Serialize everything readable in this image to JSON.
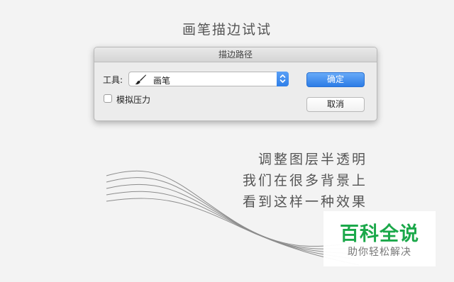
{
  "page": {
    "title": "画笔描边试试"
  },
  "dialog": {
    "title": "描边路径",
    "tool_label": "工具:",
    "tool_value": "画笔",
    "tool_icon": "brush-icon",
    "checkbox_label": "模拟压力",
    "checkbox_checked": false,
    "ok_label": "确定",
    "cancel_label": "取消",
    "accent_color": "#2f7fe8"
  },
  "poem": {
    "lines": [
      "调整图层半透明",
      "我们在很多背景上",
      "看到这样一种效果"
    ]
  },
  "watermark": {
    "title": "百科全说",
    "subtitle": "助你轻松解决",
    "color": "#1ba84a"
  }
}
